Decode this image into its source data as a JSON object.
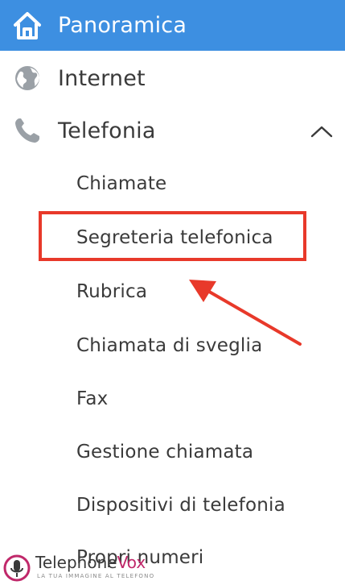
{
  "menu": {
    "panoramica": {
      "label": "Panoramica",
      "icon": "home-icon"
    },
    "internet": {
      "label": "Internet",
      "icon": "globe-icon"
    },
    "telefonia": {
      "label": "Telefonia",
      "icon": "phone-icon",
      "expanded": true
    },
    "telefonia_items": [
      {
        "label": "Chiamate"
      },
      {
        "label": "Segreteria telefonica",
        "highlighted": true
      },
      {
        "label": "Rubrica"
      },
      {
        "label": "Chiamata di sveglia"
      },
      {
        "label": "Fax"
      },
      {
        "label": "Gestione chiamata"
      },
      {
        "label": "Dispositivi di telefonia"
      },
      {
        "label": "Propri numeri"
      }
    ]
  },
  "watermark": {
    "brand_main": "Telephone",
    "brand_accent": "Vox",
    "tagline": "LA TUA IMMAGINE AL TELEFONO"
  },
  "colors": {
    "active_bg": "#3d8fe1",
    "highlight": "#e8392a",
    "text": "#3a3a3a",
    "brand_accent": "#c0286a"
  }
}
